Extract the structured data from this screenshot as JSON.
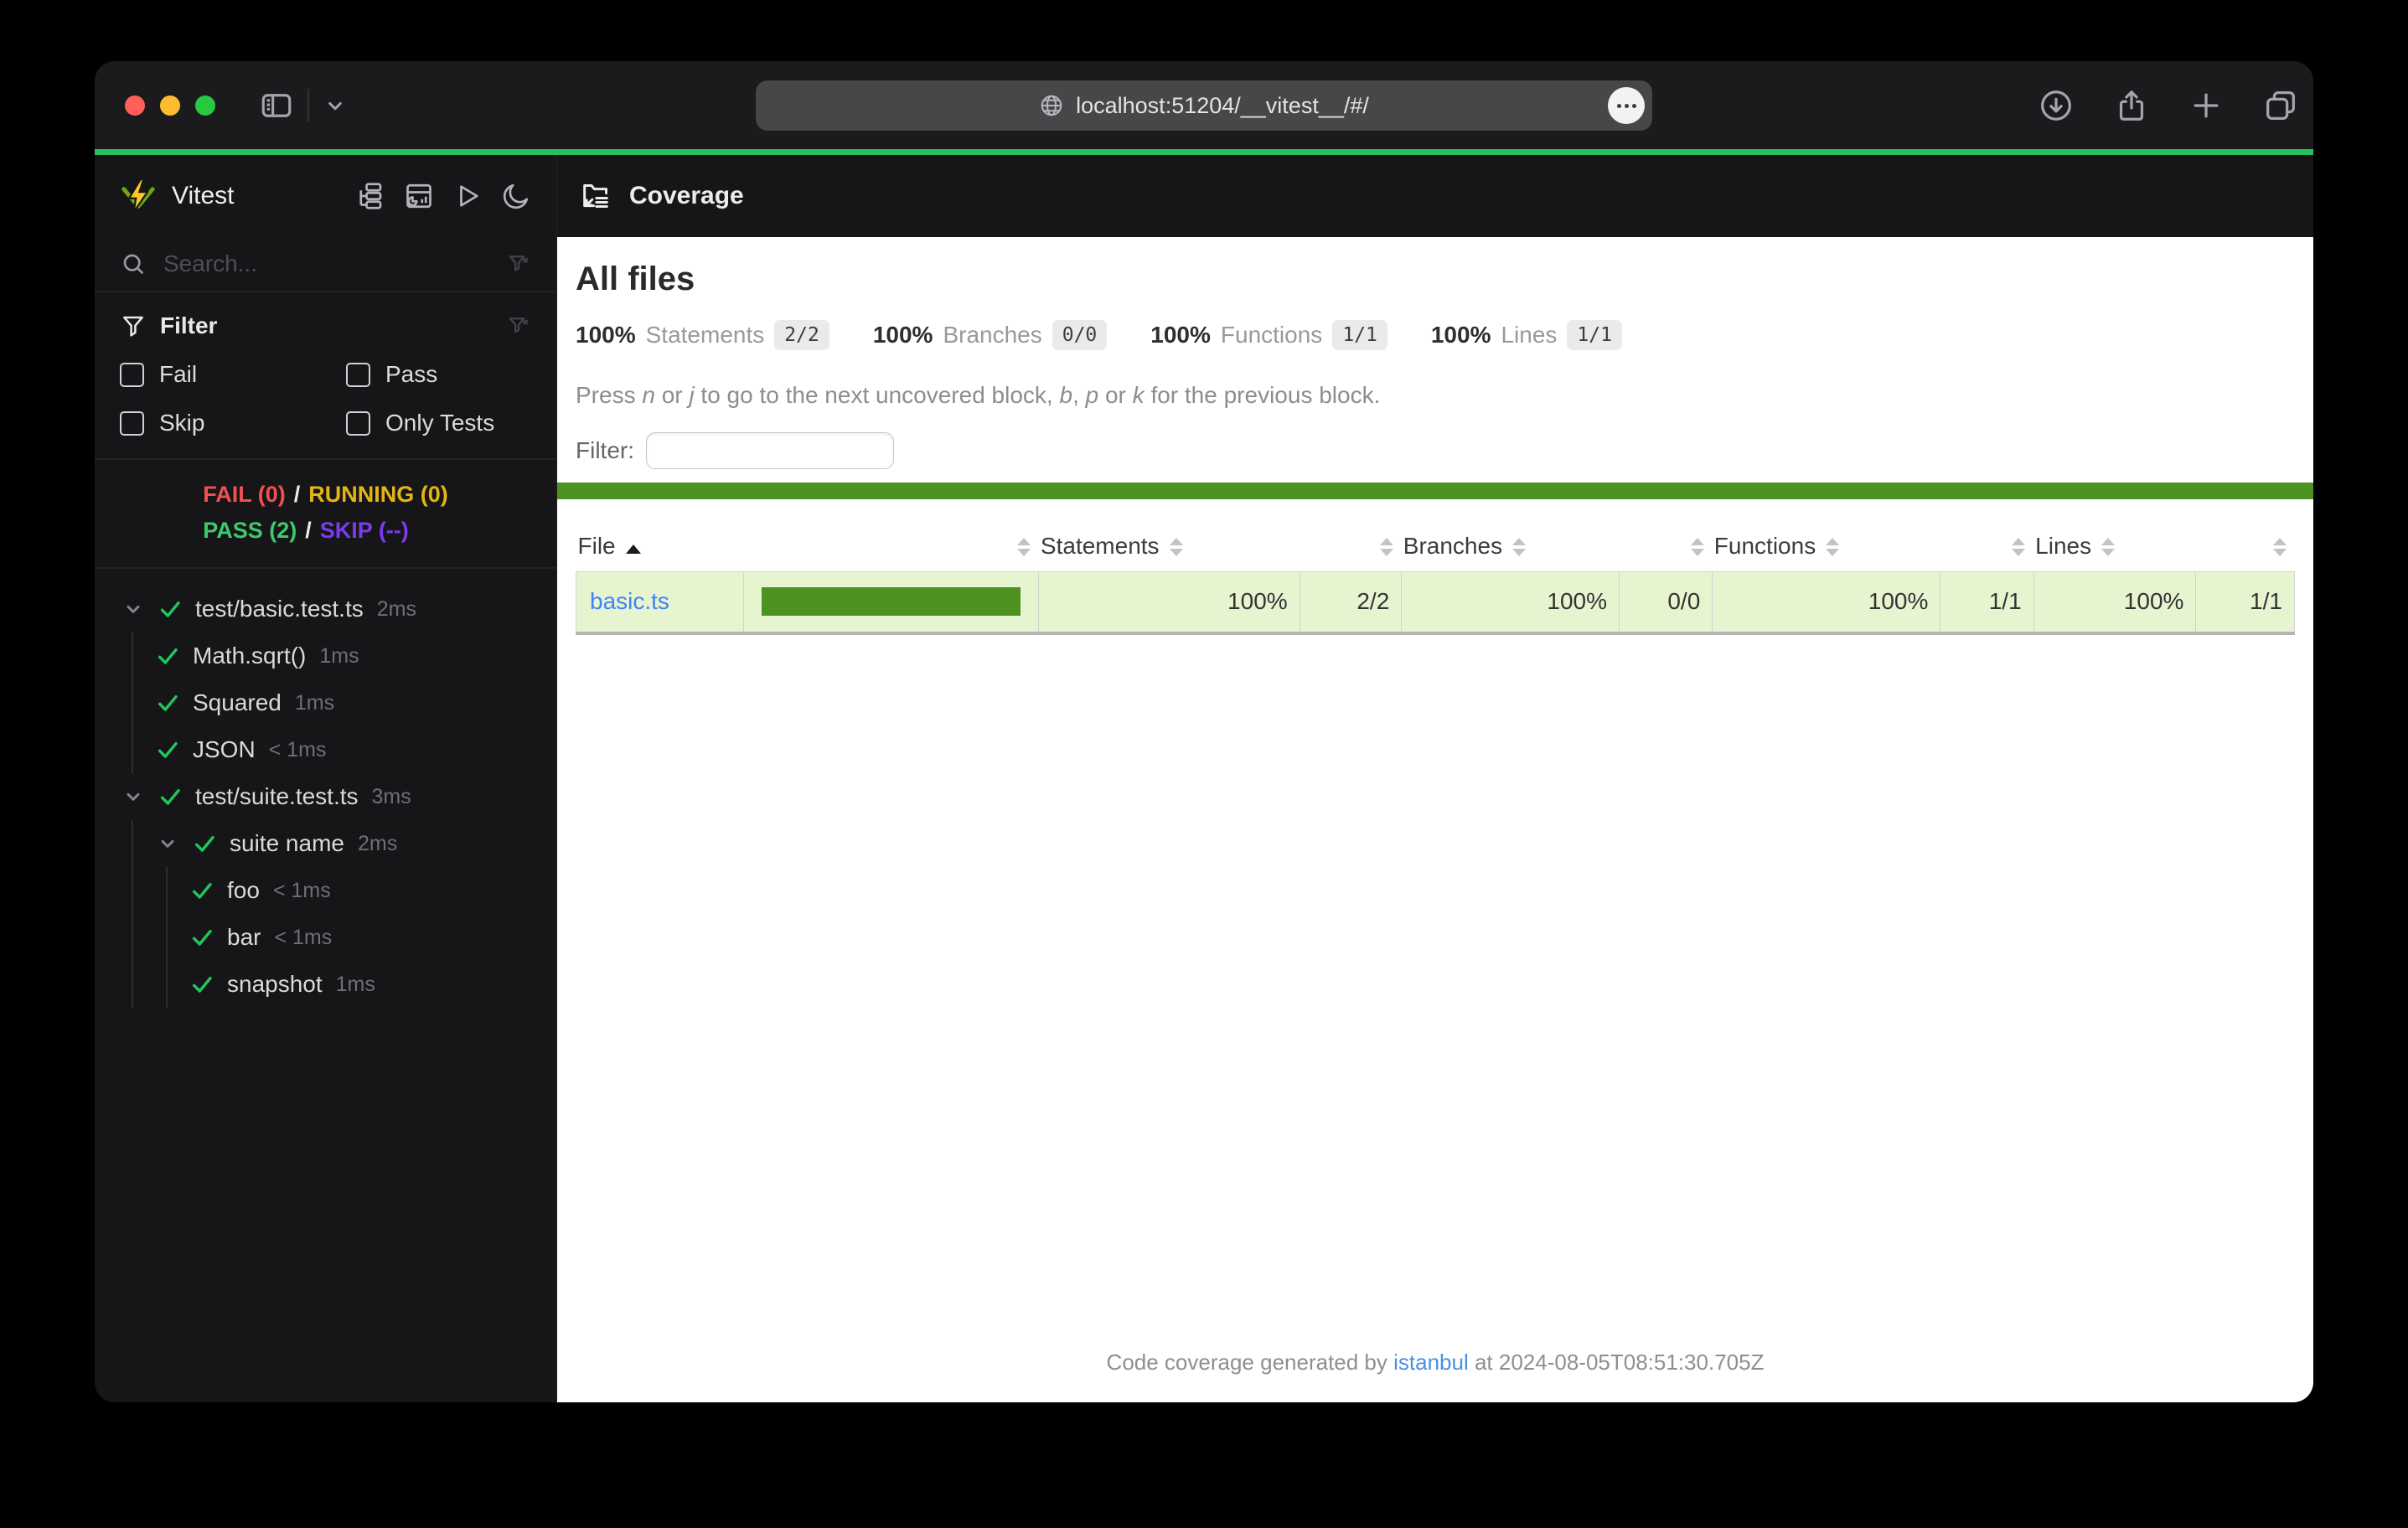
{
  "browser": {
    "url": "localhost:51204/__vitest__/#/"
  },
  "theme": {
    "accent_green": "#24c15c",
    "coverage_green": "#4d9221",
    "row_bg": "#e6f5d0",
    "link_blue": "#3f83f8",
    "traffic_red": "#ff5f57",
    "traffic_yellow": "#febc2e",
    "traffic_green": "#28c840"
  },
  "sidebar": {
    "title": "Vitest",
    "search_placeholder": "Search...",
    "filter": {
      "label": "Filter",
      "options": [
        {
          "label": "Fail"
        },
        {
          "label": "Pass"
        },
        {
          "label": "Skip"
        },
        {
          "label": "Only Tests"
        }
      ]
    },
    "status": {
      "line1": [
        {
          "text": "FAIL (0)",
          "color": "#f25050"
        },
        {
          "text": "/",
          "color": "#ececec"
        },
        {
          "text": "RUNNING (0)",
          "color": "#e5b githubusercontent413",
          "colorfix": ""
        }
      ],
      "line2": [
        {
          "text": "PASS (2)",
          "color": "#3ec96f"
        },
        {
          "text": "/",
          "color": "#ececec"
        },
        {
          "text": "SKIP (--)",
          "color": "#7c3aed"
        }
      ]
    },
    "tree": [
      {
        "label": "test/basic.test.ts",
        "duration": "2ms",
        "children": [
          {
            "label": "Math.sqrt()",
            "duration": "1ms"
          },
          {
            "label": "Squared",
            "duration": "1ms"
          },
          {
            "label": "JSON",
            "duration": "< 1ms"
          }
        ]
      },
      {
        "label": "test/suite.test.ts",
        "duration": "3ms",
        "children": [
          {
            "label": "suite name",
            "duration": "2ms",
            "children": [
              {
                "label": "foo",
                "duration": "< 1ms"
              },
              {
                "label": "bar",
                "duration": "< 1ms"
              },
              {
                "label": "snapshot",
                "duration": "1ms"
              }
            ]
          }
        ]
      }
    ]
  },
  "coverage": {
    "tab_title": "Coverage",
    "heading": "All files",
    "stats": [
      {
        "pct": "100%",
        "label": "Statements",
        "frac": "2/2"
      },
      {
        "pct": "100%",
        "label": "Branches",
        "frac": "0/0"
      },
      {
        "pct": "100%",
        "label": "Functions",
        "frac": "1/1"
      },
      {
        "pct": "100%",
        "label": "Lines",
        "frac": "1/1"
      }
    ],
    "hint": {
      "t1": "Press ",
      "k1": "n",
      "t2": " or ",
      "k2": "j",
      "t3": " to go to the next uncovered block, ",
      "k3": "b",
      "t4": ", ",
      "k4": "p",
      "t5": " or ",
      "k5": "k",
      "t6": " for the previous block."
    },
    "filter_label": "Filter:",
    "table": {
      "headers": {
        "file": "File",
        "statements": "Statements",
        "branches": "Branches",
        "functions": "Functions",
        "lines": "Lines"
      },
      "row": {
        "file": "basic.ts",
        "bar_pct": 100,
        "statements_pct": "100%",
        "statements_frac": "2/2",
        "branches_pct": "100%",
        "branches_frac": "0/0",
        "functions_pct": "100%",
        "functions_frac": "1/1",
        "lines_pct": "100%",
        "lines_frac": "1/1"
      }
    },
    "footer": {
      "t1": "Code coverage generated by ",
      "link": "istanbul",
      "t2": " at 2024-08-05T08:51:30.705Z"
    }
  }
}
